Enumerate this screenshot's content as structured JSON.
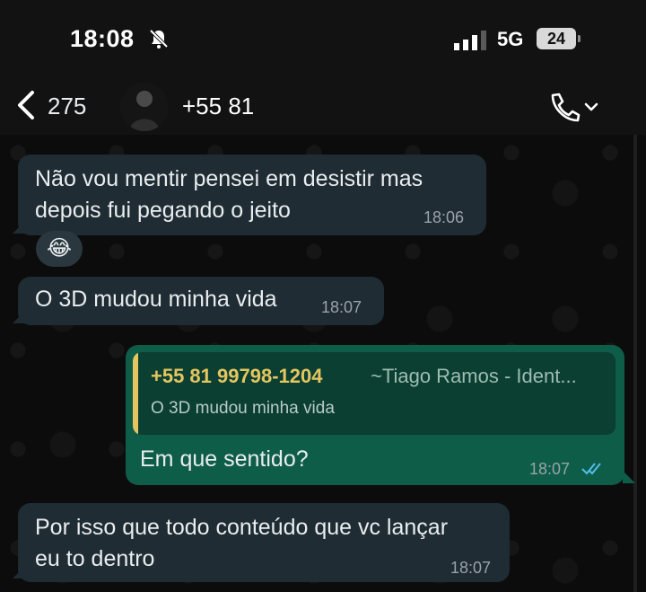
{
  "status_bar": {
    "time": "18:08",
    "network": "5G",
    "battery": "24",
    "icons": [
      "bell-muted-icon",
      "signal-icon",
      "battery-icon"
    ]
  },
  "header": {
    "back_count": "275",
    "contact_name": "+55 81",
    "icons": [
      "back-chevron-icon",
      "avatar",
      "phone-icon",
      "chevron-down-icon"
    ]
  },
  "messages": [
    {
      "direction": "incoming",
      "lines": [
        "Não vou mentir pensei em desistir mas",
        "depois fui pegando o jeito"
      ],
      "time": "18:06",
      "reaction": "😂"
    },
    {
      "direction": "incoming",
      "lines": [
        "O 3D mudou minha vida"
      ],
      "time": "18:07"
    },
    {
      "direction": "outgoing",
      "quote": {
        "author": "+55 81 99798-1204",
        "pushname": "~Tiago Ramos - Ident...",
        "text": "O 3D mudou minha vida"
      },
      "lines": [
        "Em que sentido?"
      ],
      "time": "18:07",
      "status": "read"
    },
    {
      "direction": "incoming",
      "lines": [
        "Por isso que todo conteúdo que vc lançar",
        "eu to dentro"
      ],
      "time": "18:07"
    }
  ],
  "colors": {
    "incoming_bubble": "#1f2c33",
    "outgoing_bubble": "#0e5d49",
    "quote_accent": "#e5c560",
    "read_ticks": "#53bdeb"
  }
}
